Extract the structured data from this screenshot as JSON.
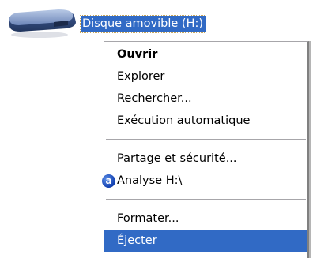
{
  "drive": {
    "label": "Disque amovible (H:)",
    "icon": "removable-drive-icon"
  },
  "menu": {
    "items": [
      {
        "label": "Ouvrir"
      },
      {
        "label": "Explorer"
      },
      {
        "label": "Rechercher..."
      },
      {
        "label": "Exécution automatique"
      },
      {
        "label": "Partage et sécurité..."
      },
      {
        "label": "Analyse H:\\",
        "icon": "antivirus-a-icon",
        "icon_glyph": "a"
      },
      {
        "label": "Formater..."
      },
      {
        "label": "Éjecter"
      }
    ]
  },
  "colors": {
    "selection": "#316ac5",
    "menu_border": "#a7a6aa"
  }
}
